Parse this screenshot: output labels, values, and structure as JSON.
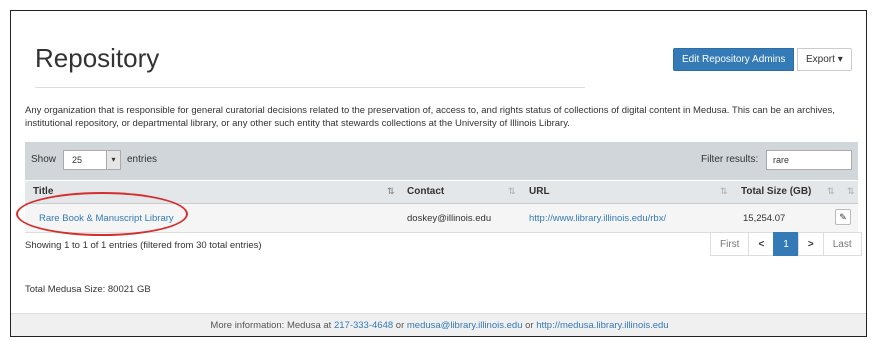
{
  "header": {
    "title": "Repository",
    "edit_admins_label": "Edit Repository Admins",
    "export_label": "Export",
    "export_caret": "▾"
  },
  "description": "Any organization that is responsible for general curatorial decisions related to the preservation of, access to, and rights status of collections of digital content in Medusa. This can be an archives, institutional repository, or departmental library, or any other such entity that stewards collections at the University of Illinois Library.",
  "table_controls": {
    "show_label": "Show",
    "page_size": "25",
    "entries_label": "entries",
    "filter_label": "Filter results:",
    "filter_value": "rare"
  },
  "table": {
    "columns": [
      "Title",
      "Contact",
      "URL",
      "Total Size (GB)"
    ],
    "rows": [
      {
        "title": "Rare Book & Manuscript Library",
        "contact": "doskey@illinois.edu",
        "url": "http://www.library.illinois.edu/rbx/",
        "size": "15,254.07"
      }
    ]
  },
  "summary": "Showing 1 to 1 of 1 entries (filtered from 30 total entries)",
  "pagination": {
    "first": "First",
    "prev": "<",
    "current": "1",
    "next": ">",
    "last": "Last"
  },
  "total_size": "Total Medusa Size: 80021 GB",
  "footer": {
    "prefix": "More information: Medusa at",
    "phone": "217-333-4648",
    "or1": "or",
    "email": "medusa@library.illinois.edu",
    "or2": "or",
    "site": "http://medusa.library.illinois.edu"
  },
  "colors": {
    "primary": "#337ab7",
    "toolbar": "#d0d6da",
    "annotation": "#d32f2f"
  }
}
